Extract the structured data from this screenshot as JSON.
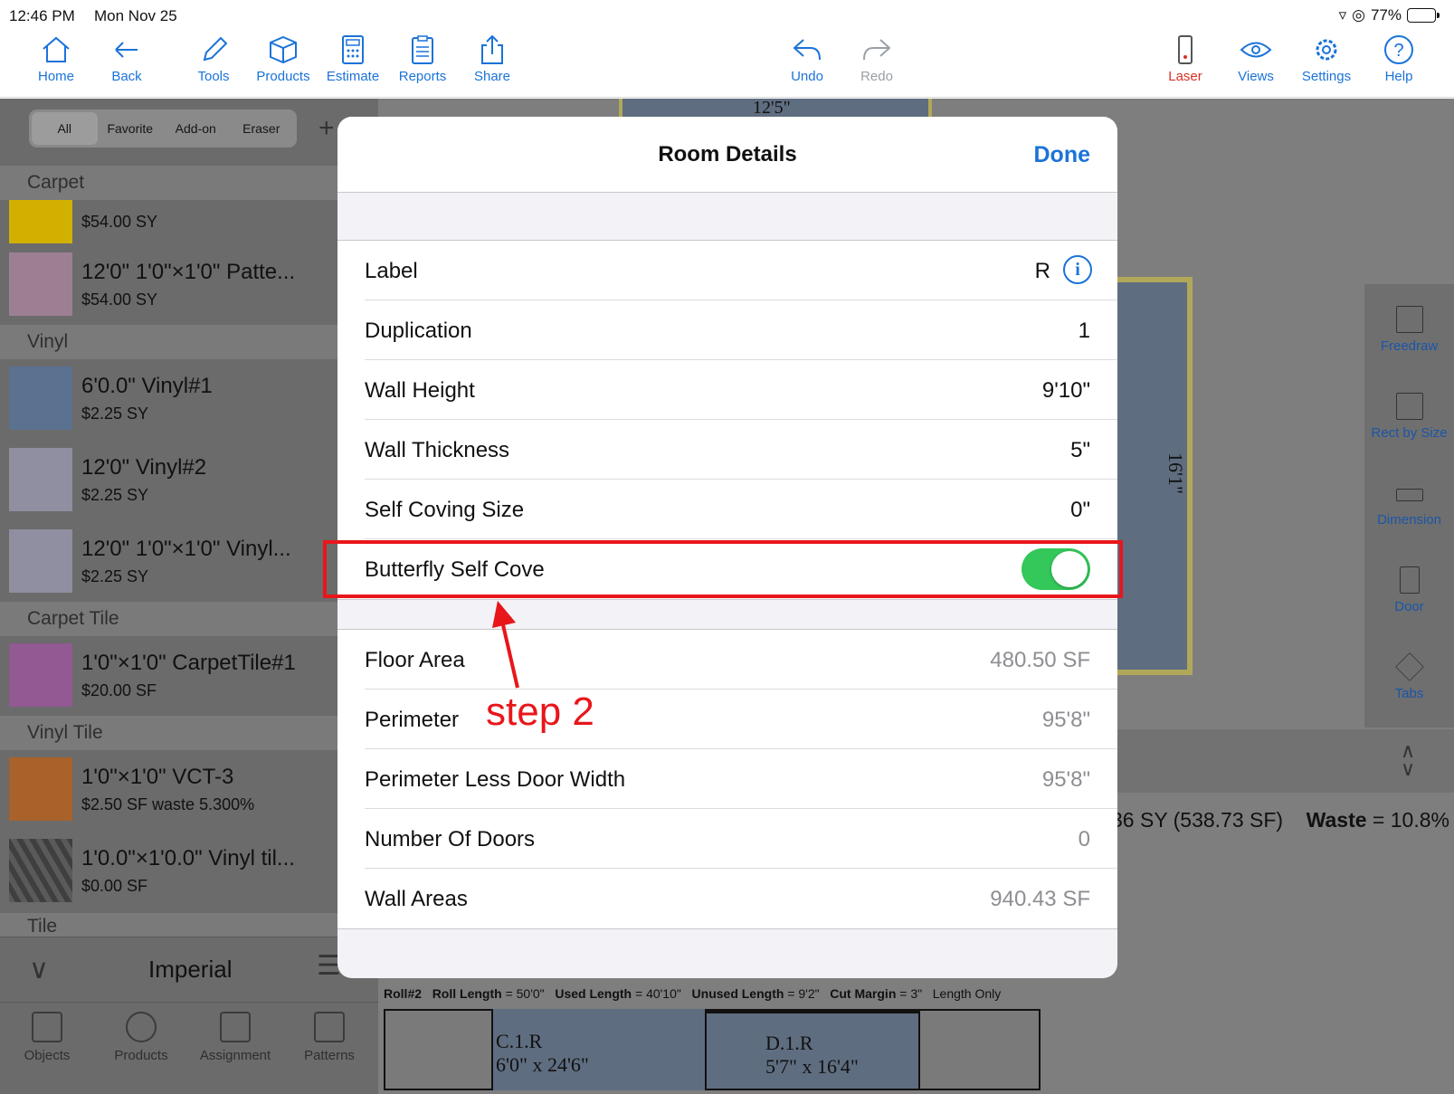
{
  "status": {
    "time": "12:46 PM",
    "date": "Mon Nov 25",
    "battery": "77%",
    "battery_level": 0.77
  },
  "toolbar": {
    "home": "Home",
    "back": "Back",
    "tools": "Tools",
    "products": "Products",
    "estimate": "Estimate",
    "reports": "Reports",
    "share": "Share",
    "undo": "Undo",
    "redo": "Redo",
    "laser": "Laser",
    "views": "Views",
    "settings": "Settings",
    "help": "Help"
  },
  "filter": {
    "all": "All",
    "favorite": "Favorite",
    "addon": "Add-on",
    "eraser": "Eraser"
  },
  "sections": {
    "carpet": "Carpet",
    "vinyl": "Vinyl",
    "carpet_tile": "Carpet Tile",
    "vinyl_tile": "Vinyl Tile",
    "tile": "Tile"
  },
  "products": [
    {
      "name": "12'0\" 1'0\"×1'0\" Patte...",
      "price": "$54.00    SY",
      "color": "#d2b000",
      "partial": true
    },
    {
      "name": "12'0\" 1'0\"×1'0\" Patte...",
      "price": "$54.00    SY",
      "color": "#9c7f93"
    },
    {
      "name": "6'0.0\" Vinyl#1",
      "price": "$2.25    SY",
      "color": "#5a7190"
    },
    {
      "name": "12'0\" Vinyl#2",
      "price": "$2.25    SY",
      "color": "#8f8fa1"
    },
    {
      "name": "12'0\" 1'0\"×1'0\" Vinyl...",
      "price": "$2.25    SY",
      "color": "#8f8fa1"
    },
    {
      "name": "1'0\"×1'0\" CarpetTile#1",
      "price": "$20.00    SF",
      "color": "#925993"
    },
    {
      "name": "1'0\"×1'0\" VCT-3",
      "price": "$2.50    SF    waste 5.300%",
      "color": "#a9622a"
    },
    {
      "name": "1'0.0\"×1'0.0\" Vinyl til...",
      "price": "$0.00    SF",
      "color": "#4b4b4b"
    }
  ],
  "units": "Imperial",
  "bottom_tabs": {
    "objects": "Objects",
    "products": "Products",
    "assignment": "Assignment",
    "patterns": "Patterns"
  },
  "draw_tools": {
    "freedraw": "Freedraw",
    "rect": "Rect by Size",
    "dimension": "Dimension",
    "door": "Door",
    "tabs": "Tabs"
  },
  "canvas": {
    "dim_top": "12'5\"",
    "dim_side": "16'1\"",
    "summary_prefix": "36 SY (538.73 SF)",
    "waste_label": "Waste",
    "waste_value": "= 10.8%",
    "roll_name": "Roll#2",
    "roll_length_label": "Roll Length",
    "roll_length": "= 50'0\"",
    "used_length_label": "Used Length",
    "used_length": "= 40'10\"",
    "unused_length_label": "Unused Length",
    "unused_length": "= 9'2\"",
    "cut_margin_label": "Cut Margin",
    "cut_margin": "= 3\"",
    "length_only": "Length Only",
    "cut1_name": "C.1.R",
    "cut1_size": "6'0\" x 24'6\"",
    "cut2_name": "D.1.R",
    "cut2_size": "5'7\" x 16'4\""
  },
  "modal": {
    "title": "Room Details",
    "done": "Done",
    "label_row": {
      "label": "Label",
      "value": "R"
    },
    "duplication": {
      "label": "Duplication",
      "value": "1"
    },
    "wall_height": {
      "label": "Wall Height",
      "value": "9'10\""
    },
    "wall_thickness": {
      "label": "Wall Thickness",
      "value": "5\""
    },
    "self_coving": {
      "label": "Self Coving Size",
      "value": "0\""
    },
    "butterfly": {
      "label": "Butterfly Self Cove",
      "on": true
    },
    "floor_area": {
      "label": "Floor Area",
      "value": "480.50 SF"
    },
    "perimeter": {
      "label": "Perimeter",
      "value": "95'8\""
    },
    "perimeter_less": {
      "label": "Perimeter Less Door Width",
      "value": "95'8\""
    },
    "doors": {
      "label": "Number Of Doors",
      "value": "0"
    },
    "wall_areas": {
      "label": "Wall Areas",
      "value": "940.43 SF"
    }
  },
  "annotation": {
    "step": "step 2",
    "color": "#e8161b"
  }
}
